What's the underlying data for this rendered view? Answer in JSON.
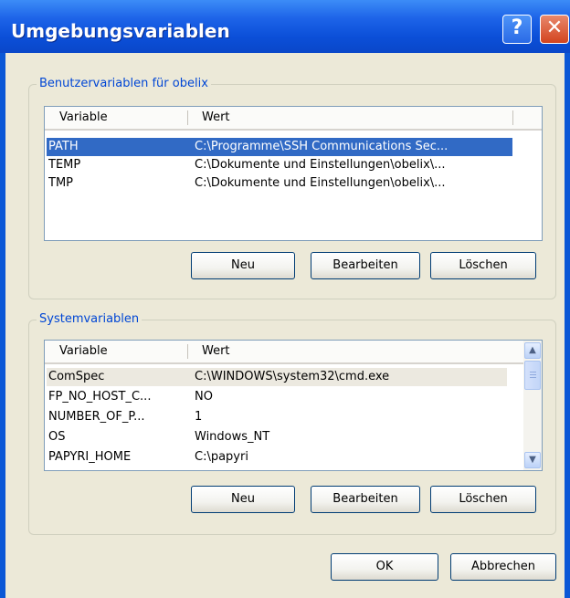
{
  "window": {
    "title": "Umgebungsvariablen",
    "help_glyph": "?",
    "close_glyph": "✕",
    "accent_color": "#0a57d6"
  },
  "user_vars": {
    "group_label": "Benutzervariablen für obelix",
    "columns": [
      "Variable",
      "Wert"
    ],
    "rows": [
      {
        "name": "PATH",
        "value": "C:\\Programme\\SSH Communications Sec...",
        "selected": true
      },
      {
        "name": "TEMP",
        "value": "C:\\Dokumente und Einstellungen\\obelix\\..."
      },
      {
        "name": "TMP",
        "value": "C:\\Dokumente und Einstellungen\\obelix\\..."
      }
    ],
    "buttons": {
      "new": "Neu",
      "edit": "Bearbeiten",
      "delete": "Löschen"
    }
  },
  "system_vars": {
    "group_label": "Systemvariablen",
    "columns": [
      "Variable",
      "Wert"
    ],
    "rows": [
      {
        "name": "ComSpec",
        "value": "C:\\WINDOWS\\system32\\cmd.exe",
        "highlighted": true
      },
      {
        "name": "FP_NO_HOST_C...",
        "value": "NO"
      },
      {
        "name": "NUMBER_OF_P...",
        "value": "1"
      },
      {
        "name": "OS",
        "value": "Windows_NT"
      },
      {
        "name": "PAPYRI_HOME",
        "value": "C:\\papyri"
      }
    ],
    "buttons": {
      "new": "Neu",
      "edit": "Bearbeiten",
      "delete": "Löschen"
    },
    "scrollbar": {
      "up_icon": "arrow-up-icon",
      "down_icon": "arrow-down-icon",
      "up_glyph": "▲",
      "down_glyph": "▼"
    }
  },
  "dialog_buttons": {
    "ok": "OK",
    "cancel": "Abbrechen"
  }
}
